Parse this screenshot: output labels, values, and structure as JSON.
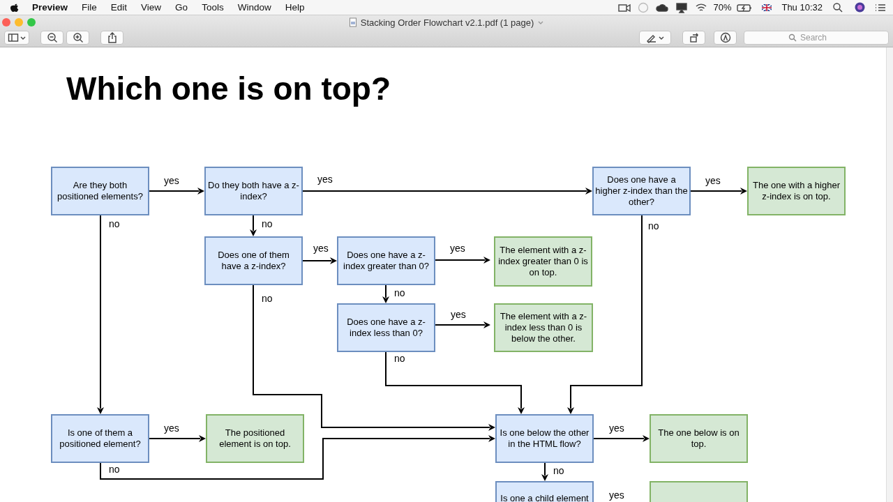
{
  "menu_bar": {
    "app": "Preview",
    "menus": [
      "File",
      "Edit",
      "View",
      "Go",
      "Tools",
      "Window",
      "Help"
    ],
    "battery": "70%",
    "clock": "Thu 10:32"
  },
  "window": {
    "title": "Stacking Order Flowchart v2.1.pdf (1 page)"
  },
  "toolbar": {
    "search": {
      "placeholder": "Search"
    }
  },
  "document": {
    "heading": "Which one is on top?",
    "flowchart": {
      "nodes": [
        {
          "kind": "decision",
          "text": "Are they both positioned elements?"
        },
        {
          "kind": "decision",
          "text": "Do they both have a z-index?"
        },
        {
          "kind": "decision",
          "text": "Does one have a higher z-index than the other?"
        },
        {
          "kind": "result",
          "text": "The one with a higher z-index is on top."
        },
        {
          "kind": "decision",
          "text": "Does one of them have a z-index?"
        },
        {
          "kind": "decision",
          "text": "Does one have a z-index greater than 0?"
        },
        {
          "kind": "result",
          "text": "The element with a z-index greater than 0 is on top."
        },
        {
          "kind": "decision",
          "text": "Does one have a z-index less than 0?"
        },
        {
          "kind": "result",
          "text": "The element with a z-index less than 0 is below the other."
        },
        {
          "kind": "decision",
          "text": "Is one of them a positioned element?"
        },
        {
          "kind": "result",
          "text": "The positioned element is on top."
        },
        {
          "kind": "decision",
          "text": "Is one below the other in the HTML flow?"
        },
        {
          "kind": "result",
          "text": "The one below is on top."
        },
        {
          "kind": "decision",
          "text": "Is one a child element"
        },
        {
          "kind": "result"
        }
      ],
      "edges": [
        {
          "kind": "arrow",
          "label": "yes"
        },
        {
          "kind": "arrow",
          "label": "yes"
        },
        {
          "kind": "arrow",
          "label": "yes"
        },
        {
          "kind": "arrow",
          "label": "no"
        },
        {
          "kind": "arrow",
          "label": "no"
        },
        {
          "kind": "arrow",
          "label": "yes"
        },
        {
          "kind": "arrow",
          "label": "yes"
        },
        {
          "kind": "arrow",
          "label": "no"
        },
        {
          "kind": "arrow",
          "label": "yes"
        },
        {
          "kind": "arrow",
          "label": "no"
        },
        {
          "kind": "arrow",
          "label": "no"
        },
        {
          "kind": "arrow",
          "label": "no"
        },
        {
          "kind": "arrow",
          "label": "yes"
        },
        {
          "kind": "arrow",
          "label": "no"
        },
        {
          "kind": "arrow",
          "label": "yes"
        },
        {
          "kind": "arrow",
          "label": "no"
        },
        {
          "kind": "label",
          "label": "yes"
        }
      ]
    }
  }
}
